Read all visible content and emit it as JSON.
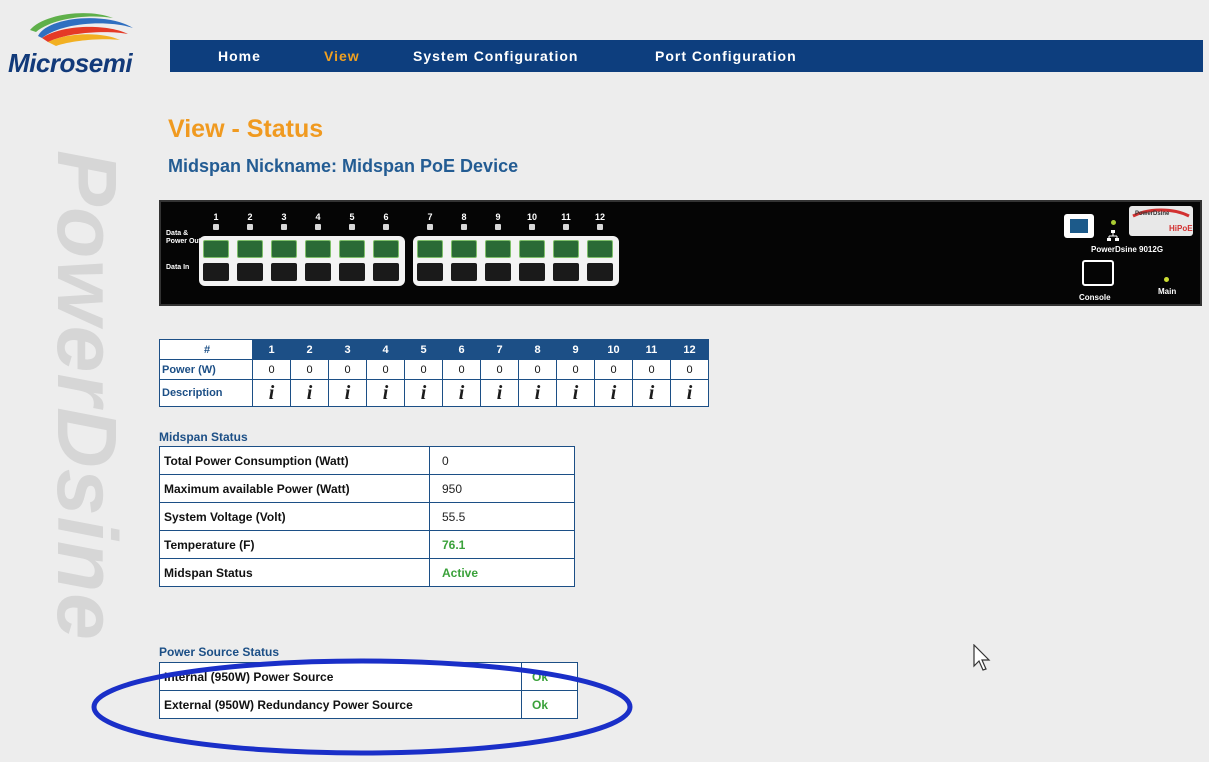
{
  "brand": {
    "logo_text": "Microsemi",
    "watermark": "PowerDsine"
  },
  "nav": {
    "items": [
      "Home",
      "View",
      "System Configuration",
      "Port Configuration"
    ],
    "active": "View"
  },
  "page": {
    "title": "View - Status",
    "subtitle": "Midspan Nickname: Midspan PoE Device"
  },
  "device": {
    "port_numbers": [
      "1",
      "2",
      "3",
      "4",
      "5",
      "6",
      "7",
      "8",
      "9",
      "10",
      "11",
      "12"
    ],
    "label_top": "Data & Power Out",
    "label_bottom": "Data In",
    "badge_text": "PowerDsine",
    "model": "PowerDsine 9012G",
    "console_label": "Console",
    "main_label": "Main"
  },
  "ports_table": {
    "header_label": "#",
    "power_label": "Power (W)",
    "description_label": "Description",
    "ports": [
      "1",
      "2",
      "3",
      "4",
      "5",
      "6",
      "7",
      "8",
      "9",
      "10",
      "11",
      "12"
    ],
    "power": [
      "0",
      "0",
      "0",
      "0",
      "0",
      "0",
      "0",
      "0",
      "0",
      "0",
      "0",
      "0"
    ],
    "info_glyph": "i"
  },
  "midspan_status": {
    "title": "Midspan Status",
    "rows": [
      {
        "label": "Total Power Consumption (Watt)",
        "value": "0"
      },
      {
        "label": "Maximum available Power (Watt)",
        "value": "950"
      },
      {
        "label": "System Voltage (Volt)",
        "value": "55.5"
      },
      {
        "label": "Temperature (F)",
        "value": "76.1"
      },
      {
        "label": "Midspan Status",
        "value": "Active"
      }
    ]
  },
  "power_source_status": {
    "title": "Power Source Status",
    "rows": [
      {
        "label": "Internal (950W) Power Source",
        "value": "Ok"
      },
      {
        "label": "External (950W) Redundancy Power Source",
        "value": "Ok"
      }
    ]
  },
  "colors": {
    "nav_bg": "#0d3e7e",
    "accent_orange": "#f09a20",
    "table_blue": "#1c4f86",
    "ok_green": "#3aa13a",
    "highlight_ellipse": "#1a2fc8"
  }
}
